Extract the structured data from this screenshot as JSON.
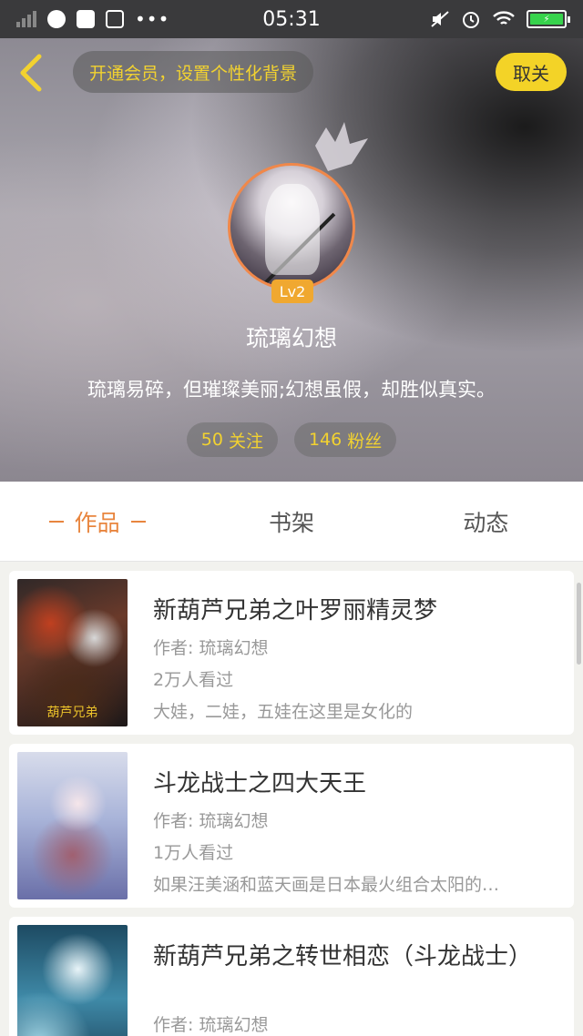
{
  "status_bar": {
    "time": "05:31",
    "battery_color": "#37d34c",
    "battery_icon": "bolt-icon",
    "left_icons": [
      "signal-icon",
      "browser-icon",
      "bag-icon",
      "s-app-icon",
      "more-dots-icon"
    ],
    "right_icons": [
      "mute-icon",
      "alarm-icon",
      "wifi-icon",
      "battery-icon"
    ],
    "more": "•••"
  },
  "header": {
    "vip_prompt": "开通会员，设置个性化背景",
    "unfollow_label": "取关",
    "level_badge": "Lv2",
    "username": "琉璃幻想",
    "bio": "琉璃易碎，但璀璨美丽;幻想虽假，却胜似真实。",
    "following_count": "50",
    "following_label": "关注",
    "followers_count": "146",
    "followers_label": "粉丝",
    "accent_color": "#f2d230"
  },
  "tabs": [
    {
      "label": "作品",
      "active": true
    },
    {
      "label": "书架",
      "active": false
    },
    {
      "label": "动态",
      "active": false
    }
  ],
  "books": [
    {
      "title": "新葫芦兄弟之叶罗丽精灵梦",
      "author": "作者: 琉璃幻想",
      "views": "2万人看过",
      "summary": "大娃，二娃，五娃在这里是女化的",
      "cover_caption": "葫芦兄弟"
    },
    {
      "title": "斗龙战士之四大天王",
      "author": "作者: 琉璃幻想",
      "views": "1万人看过",
      "summary": "如果汪美涵和蓝天画是日本最火组合太阳的…"
    },
    {
      "title": "新葫芦兄弟之转世相恋（斗龙战士）",
      "author": "作者: 琉璃幻想"
    }
  ]
}
